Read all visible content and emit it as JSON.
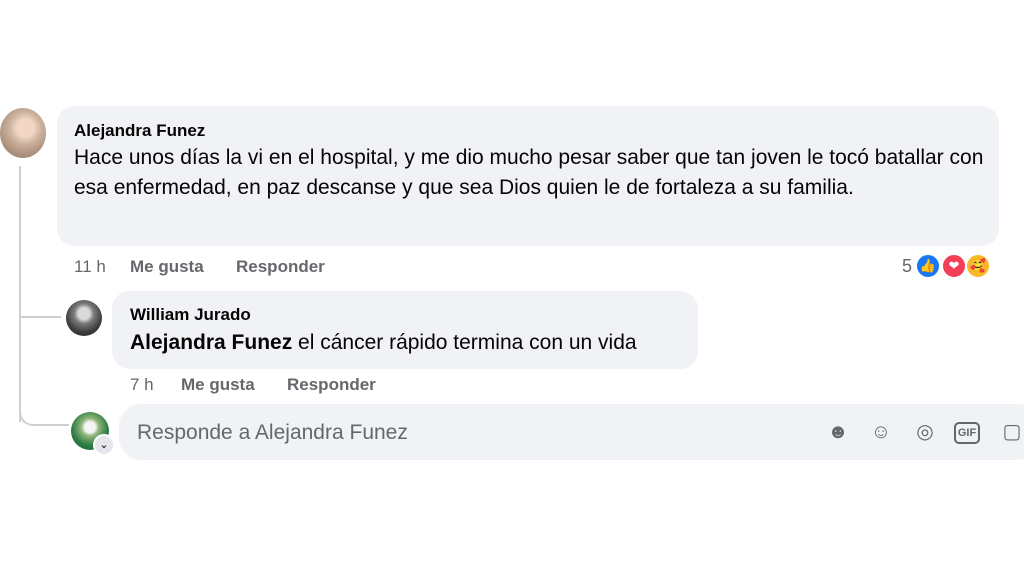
{
  "main_comment": {
    "author": "Alejandra Funez",
    "text": "Hace unos días la vi en el hospital, y me dio mucho pesar saber que tan joven le tocó batallar con esa enfermedad, en paz descanse y que sea Dios quien le de fortaleza a su familia.",
    "time": "11 h",
    "like_label": "Me gusta",
    "reply_label": "Responder",
    "reaction_count": "5",
    "reactions": [
      "like-icon",
      "love-icon",
      "care-icon"
    ]
  },
  "reply_comment": {
    "author": "William Jurado",
    "mention": "Alejandra Funez",
    "text": " el cáncer rápido termina con un vida",
    "time": "7 h",
    "like_label": "Me gusta",
    "reply_label": "Responder"
  },
  "composer": {
    "placeholder": "Responde a Alejandra Funez",
    "tools": [
      "avatar-sticker-icon",
      "emoji-icon",
      "camera-icon",
      "gif-icon",
      "sticker-icon"
    ],
    "gif_label": "GIF"
  },
  "colors": {
    "bubble": "#f0f2f5",
    "muted_text": "#65676b",
    "like_blue": "#1877f2",
    "love_red": "#f33e58",
    "care_yellow": "#f7b928"
  }
}
